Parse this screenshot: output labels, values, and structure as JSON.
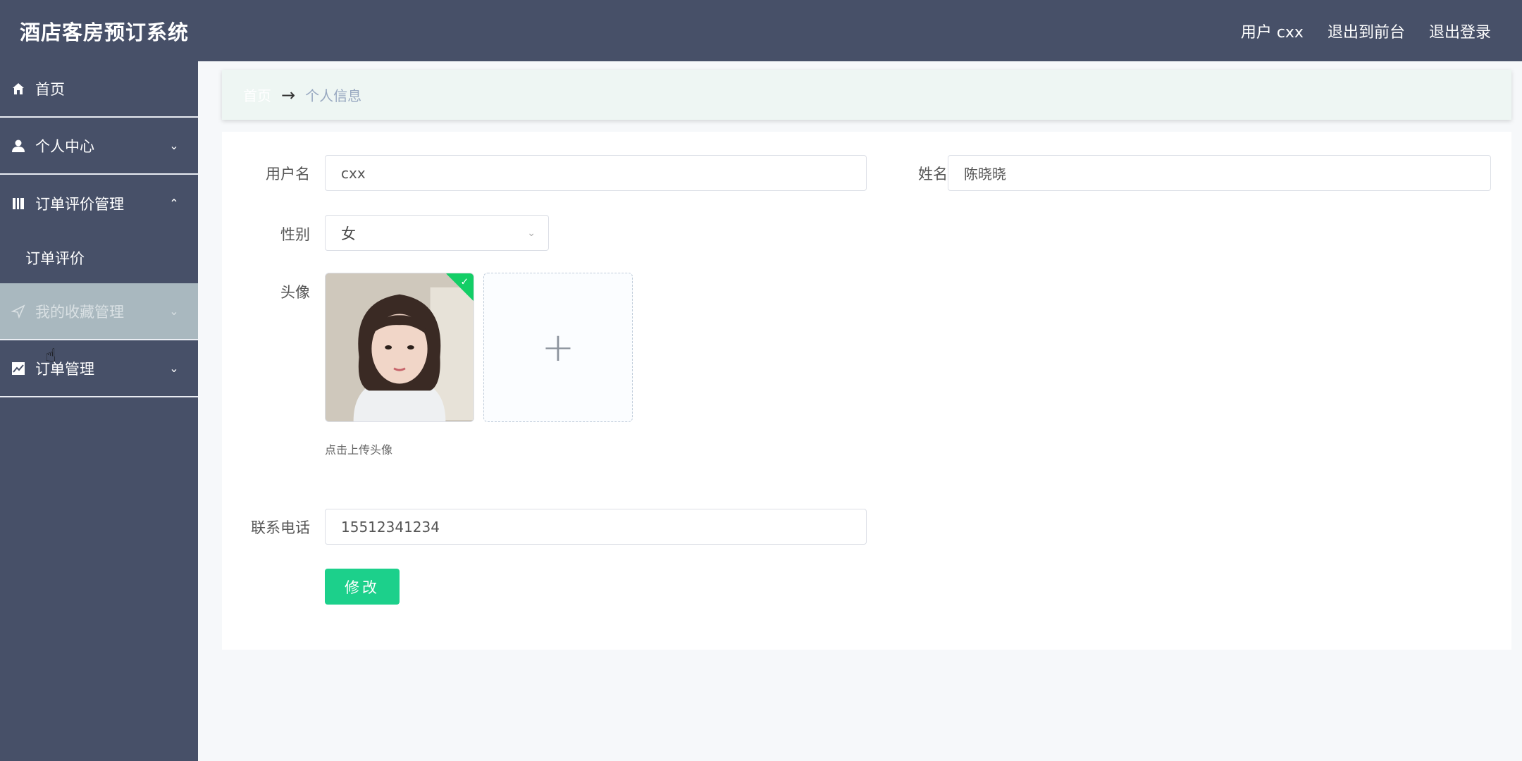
{
  "header": {
    "title": "酒店客房预订系统",
    "user_label": "用户 cxx",
    "to_front_label": "退出到前台",
    "logout_label": "退出登录"
  },
  "sidebar": {
    "items": [
      {
        "label": "首页",
        "icon": "home-icon"
      },
      {
        "label": "个人中心",
        "icon": "user-icon",
        "expanded": false
      },
      {
        "label": "订单评价管理",
        "icon": "book-icon",
        "expanded": true,
        "children": [
          {
            "label": "订单评价"
          }
        ]
      },
      {
        "label": "我的收藏管理",
        "icon": "send-icon",
        "expanded": false,
        "hovered": true
      },
      {
        "label": "订单管理",
        "icon": "chart-icon",
        "expanded": false
      }
    ]
  },
  "breadcrumb": {
    "home": "首页",
    "separator": "→",
    "current": "个人信息"
  },
  "form": {
    "username_label": "用户名",
    "username_value": "cxx",
    "name_label": "姓名",
    "name_value": "陈晓晓",
    "gender_label": "性别",
    "gender_value": "女",
    "avatar_label": "头像",
    "upload_plus": "+",
    "upload_hint": "点击上传头像",
    "phone_label": "联系电话",
    "phone_value": "15512341234",
    "submit_label": "修改"
  },
  "colors": {
    "nav_bg": "#475068",
    "accent": "#1cd08b",
    "breadcrumb_bg": "#eef6f3"
  }
}
